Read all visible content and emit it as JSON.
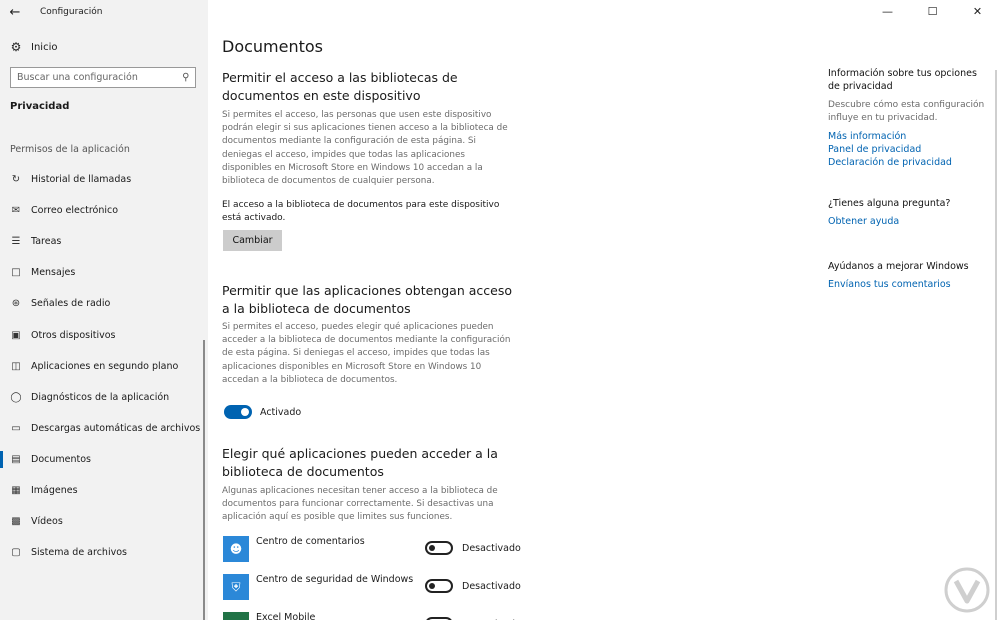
{
  "window": {
    "title": "Configuración"
  },
  "sidebar": {
    "home": "Inicio",
    "search_placeholder": "Buscar una configuración",
    "section": "Privacidad",
    "group": "Permisos de la aplicación",
    "items": [
      {
        "label": "Historial de llamadas",
        "icon": "call-history-icon"
      },
      {
        "label": "Correo electrónico",
        "icon": "mail-icon"
      },
      {
        "label": "Tareas",
        "icon": "tasks-icon"
      },
      {
        "label": "Mensajes",
        "icon": "messages-icon"
      },
      {
        "label": "Señales de radio",
        "icon": "radio-icon"
      },
      {
        "label": "Otros dispositivos",
        "icon": "devices-icon"
      },
      {
        "label": "Aplicaciones en segundo plano",
        "icon": "background-apps-icon"
      },
      {
        "label": "Diagnósticos de la aplicación",
        "icon": "diagnostics-icon"
      },
      {
        "label": "Descargas automáticas de archivos",
        "icon": "downloads-icon"
      },
      {
        "label": "Documentos",
        "icon": "documents-icon",
        "active": true
      },
      {
        "label": "Imágenes",
        "icon": "pictures-icon"
      },
      {
        "label": "Vídeos",
        "icon": "videos-icon"
      },
      {
        "label": "Sistema de archivos",
        "icon": "file-system-icon"
      }
    ]
  },
  "main": {
    "title": "Documentos",
    "sec1": {
      "heading": "Permitir el acceso a las bibliotecas de documentos en este dispositivo",
      "desc": "Si permites el acceso, las personas que usen este dispositivo podrán elegir si sus aplicaciones tienen acceso a la biblioteca de documentos mediante la configuración de esta página. Si deniegas el acceso, impides que todas las aplicaciones disponibles en Microsoft Store en Windows 10 accedan a la biblioteca de documentos de cualquier persona.",
      "status": "El acceso a la biblioteca de documentos para este dispositivo está activado.",
      "button": "Cambiar"
    },
    "sec2": {
      "heading": "Permitir que las aplicaciones obtengan acceso a la biblioteca de documentos",
      "desc": "Si permites el acceso, puedes elegir qué aplicaciones pueden acceder a la biblioteca de documentos mediante la configuración de esta página. Si deniegas el acceso, impides que todas las aplicaciones disponibles en Microsoft Store en Windows 10 accedan a la biblioteca de documentos.",
      "toggle_label": "Activado",
      "toggle_on": true
    },
    "sec3": {
      "heading": "Elegir qué aplicaciones pueden acceder a la biblioteca de documentos",
      "desc": "Algunas aplicaciones necesitan tener acceso a la biblioteca de documentos para funcionar correctamente. Si desactivas una aplicación aquí es posible que limites sus funciones.",
      "apps": [
        {
          "name": "Centro de comentarios",
          "state": "Desactivado",
          "color": "#2b88d8"
        },
        {
          "name": "Centro de seguridad de Windows D...",
          "state": "Desactivado",
          "color": "#2b88d8"
        },
        {
          "name": "Excel Mobile",
          "state": "Desactivado",
          "color": "#217346"
        }
      ]
    }
  },
  "right": {
    "info_heading": "Información sobre tus opciones de privacidad",
    "info_desc": "Descubre cómo esta configuración influye en tu privacidad.",
    "links": [
      "Más información",
      "Panel de privacidad",
      "Declaración de privacidad"
    ],
    "question_heading": "¿Tienes alguna pregunta?",
    "help_link": "Obtener ayuda",
    "improve_heading": "Ayúdanos a mejorar Windows",
    "feedback_link": "Envíanos tus comentarios"
  },
  "accent": "#0063b1"
}
